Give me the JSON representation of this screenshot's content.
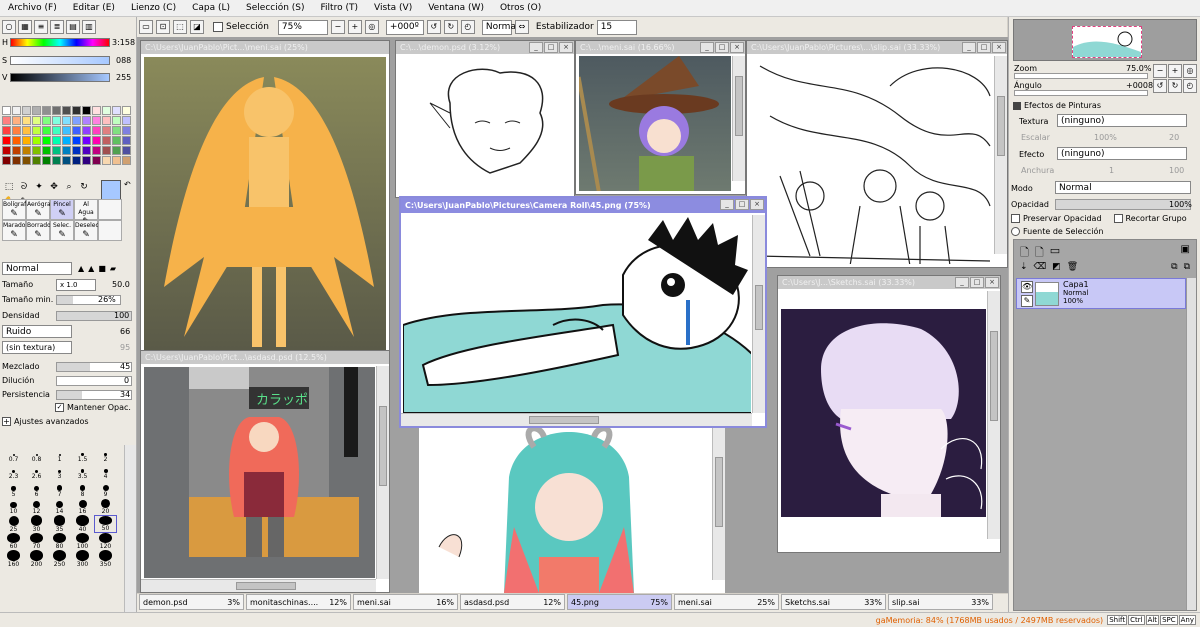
{
  "menu": [
    "Archivo (F)",
    "Editar (E)",
    "Lienzo (C)",
    "Capa (L)",
    "Selección (S)",
    "Filtro (T)",
    "Vista (V)",
    "Ventana (W)",
    "Otros (O)"
  ],
  "toolbar": {
    "selection_label": "Selección",
    "zoom": "75%",
    "rotation": "+000º",
    "blend": "Normal",
    "stabilizer_label": "Estabilizador",
    "stabilizer": "15"
  },
  "color": {
    "h_label": "H",
    "h_value": "3:158",
    "s_label": "S",
    "s_value": "088",
    "v_label": "V",
    "v_value": "255",
    "fg": "#a6c8ff",
    "bg": "#a8b87a"
  },
  "palette": [
    "#ffffff",
    "#f0f0f0",
    "#d0d0d0",
    "#b0b0b0",
    "#909090",
    "#707070",
    "#505050",
    "#303030",
    "#000000",
    "#ffe0e0",
    "#e0ffe0",
    "#e0e0ff",
    "#ffffe0",
    "#ff8080",
    "#ffb080",
    "#ffe080",
    "#e0ff80",
    "#80ff80",
    "#80ffe0",
    "#80e0ff",
    "#80a0ff",
    "#b080ff",
    "#ff80e0",
    "#ffc0c0",
    "#c0ffc0",
    "#c0c0ff",
    "#ff4040",
    "#ff8040",
    "#ffc040",
    "#c0ff40",
    "#40ff40",
    "#40ffc0",
    "#40c0ff",
    "#4060ff",
    "#9040ff",
    "#ff40c0",
    "#e08080",
    "#80e080",
    "#8080e0",
    "#ff0000",
    "#ff6000",
    "#ffb000",
    "#a0ff00",
    "#00ff00",
    "#00ffb0",
    "#00b0ff",
    "#0040ff",
    "#7000ff",
    "#ff00b0",
    "#c06060",
    "#60c060",
    "#6060c0",
    "#c00000",
    "#c04000",
    "#c08000",
    "#80c000",
    "#00c000",
    "#00c080",
    "#0080c0",
    "#0030c0",
    "#5000c0",
    "#c00080",
    "#a05050",
    "#50a050",
    "#5050a0",
    "#800000",
    "#803000",
    "#805000",
    "#508000",
    "#008000",
    "#008050",
    "#005080",
    "#002080",
    "#300080",
    "#800050",
    "#f8d8b0",
    "#f0c090",
    "#d0a070"
  ],
  "tools_icons": [
    "select-rect-icon",
    "lasso-icon",
    "magic-wand-icon",
    "move-icon",
    "zoom-icon",
    "rotate-icon",
    "hand-icon",
    "eyedropper-icon"
  ],
  "brushes": [
    {
      "label": "Bolígrafo"
    },
    {
      "label": "Aerógraf"
    },
    {
      "label": "Pincel",
      "selected": true
    },
    {
      "label": "Al Agua"
    },
    {
      "label": ""
    },
    {
      "label": "Marador"
    },
    {
      "label": "Borrador"
    },
    {
      "label": "Selec."
    },
    {
      "label": "Deselec."
    },
    {
      "label": ""
    }
  ],
  "brush_opts": {
    "mode": "Normal",
    "size_label": "Tamaño",
    "size_mult": "x 1.0",
    "size": "50.0",
    "min_label": "Tamaño min.",
    "min": "26%",
    "min_level": 0.26,
    "density_label": "Densidad",
    "density": "100",
    "density_level": 1.0,
    "noise": "Ruido",
    "noise_val": "66",
    "texture": "(sin textura)",
    "texture_val": "95",
    "mix_label": "Mezclado",
    "mix": "45",
    "mix_level": 0.45,
    "dilution_label": "Dilución",
    "dilution": "0",
    "dilution_level": 0,
    "persist_label": "Persistencia",
    "persist": "34",
    "persist_level": 0.34,
    "keep_opacity": "Mantener Opac.",
    "advanced": "Ajustes avanzados"
  },
  "sizes": [
    "0.7",
    "0.8",
    "1",
    "1.5",
    "2",
    "2.3",
    "2.6",
    "3",
    "3.5",
    "4",
    "5",
    "6",
    "7",
    "8",
    "9",
    "10",
    "12",
    "14",
    "16",
    "20",
    "25",
    "30",
    "35",
    "40",
    "50",
    "60",
    "70",
    "80",
    "100",
    "120",
    "160",
    "200",
    "250",
    "300",
    "350"
  ],
  "windows": [
    {
      "title": "C:\\Users\\JuanPablo\\Pict...\\meni.sai (25%)"
    },
    {
      "title": "C:\\...\\demon.psd (3.12%)"
    },
    {
      "title": "C:\\...\\meni.sai (16.66%)"
    },
    {
      "title": "C:\\Users\\JuanPablo\\Pictures\\...\\slip.sai (33.33%)"
    },
    {
      "title": "C:\\Users\\JuanPablo\\Pict...\\asdasd.psd (12.5%)"
    },
    {
      "title": "C:\\Users\\JuanPablo\\Pictures\\Camera Roll\\45.png (75%)"
    },
    {
      "title": "C:\\Users\\J...\\Sketchs.sai (33.33%)"
    }
  ],
  "tabs": [
    {
      "name": "demon.psd",
      "zoom": "3%"
    },
    {
      "name": "monitaschinas....",
      "zoom": "12%"
    },
    {
      "name": "meni.sai",
      "zoom": "16%"
    },
    {
      "name": "asdasd.psd",
      "zoom": "12%"
    },
    {
      "name": "45.png",
      "zoom": "75%",
      "active": true
    },
    {
      "name": "meni.sai",
      "zoom": "25%"
    },
    {
      "name": "Sketchs.sai",
      "zoom": "33%"
    },
    {
      "name": "slip.sai",
      "zoom": "33%"
    }
  ],
  "navigator": {
    "zoom_label": "Zoom",
    "zoom": "75.0%",
    "angle_label": "Ángulo",
    "angle": "+0008"
  },
  "effects": {
    "title": "Efectos de Pinturas",
    "texture_label": "Textura",
    "texture": "(ninguno)",
    "scale_label": "Escalar",
    "scale": "100%",
    "scale_val": "20",
    "effect_label": "Efecto",
    "effect": "(ninguno)",
    "width_label": "Anchura",
    "width": "1",
    "width_val": "100"
  },
  "layer_opts": {
    "mode_label": "Modo",
    "mode": "Normal",
    "opacity_label": "Opacidad",
    "opacity": "100%",
    "preserve": "Preservar Opacidad",
    "clip": "Recortar Grupo",
    "source": "Fuente de Selección"
  },
  "layer": {
    "name": "Capa1",
    "mode": "Normal",
    "opacity": "100%"
  },
  "status": {
    "memory": "gaMemoria: 84% (1768MB usados / 2497MB reservados)",
    "keys": [
      "Shift",
      "Ctrl",
      "Alt",
      "SPC",
      "Any"
    ]
  }
}
